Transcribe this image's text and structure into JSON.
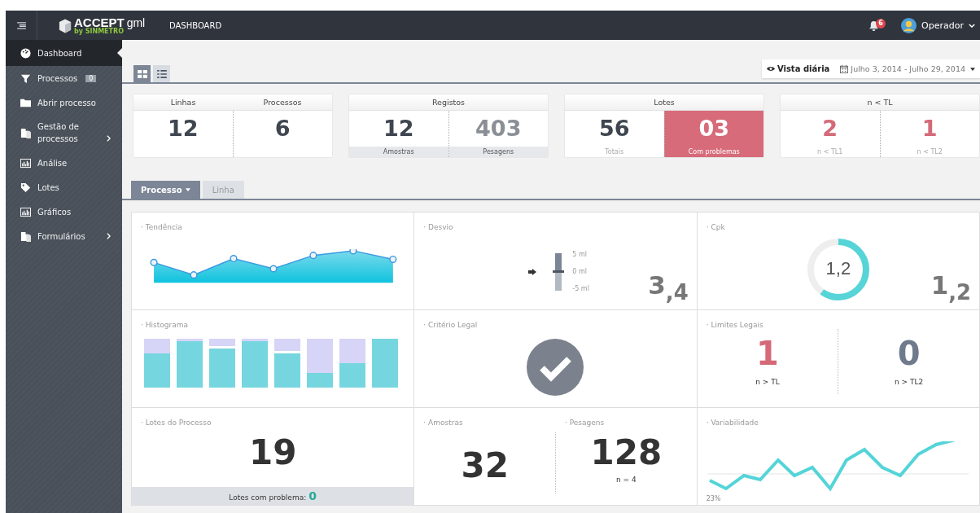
{
  "topbar": {
    "brand": "ACCEPT",
    "brand_suffix": "gml",
    "byline": "by SINMETRO",
    "page_title": "DASHBOARD",
    "notifications": "6",
    "user": "Operador"
  },
  "sidebar": {
    "items": [
      {
        "label": "Dashboard",
        "kind": "gauge",
        "selected": true,
        "expandable": false
      },
      {
        "label": "Processos",
        "kind": "filter",
        "badge": "0",
        "selected": false,
        "expandable": false
      },
      {
        "label": "Abrir processo",
        "kind": "folder",
        "selected": false,
        "expandable": false
      },
      {
        "label": "Gestão de processos",
        "kind": "document",
        "selected": false,
        "expandable": true
      },
      {
        "label": "Análise",
        "kind": "chart",
        "selected": false,
        "expandable": false
      },
      {
        "label": "Lotes",
        "kind": "tag",
        "selected": false,
        "expandable": false
      },
      {
        "label": "Gráficos",
        "kind": "chart",
        "selected": false,
        "expandable": false
      },
      {
        "label": "Formulários",
        "kind": "document",
        "selected": false,
        "expandable": true
      }
    ]
  },
  "view_toggle": [
    {
      "kind": "grid",
      "selected": true
    },
    {
      "kind": "list",
      "selected": false
    }
  ],
  "date_bar": {
    "view": "Vista diária",
    "range": "Julho 3, 2014 - Julho 29, 2014"
  },
  "stat_cards": [
    {
      "headers": [
        "Linhas",
        "Processos"
      ],
      "cells": [
        {
          "value": "12",
          "color": "#3f4650",
          "highlighted": false
        },
        {
          "value": "6",
          "color": "#3f4650",
          "highlighted": false
        }
      ]
    },
    {
      "headers": [
        "Registos"
      ],
      "shaded_captions": true,
      "cells": [
        {
          "value": "12",
          "caption": "Amostras",
          "color": "#3f4650",
          "highlighted": false
        },
        {
          "value": "403",
          "caption": "Pesagens",
          "color": "#8a8f96",
          "highlighted": false
        }
      ]
    },
    {
      "headers": [
        "Lotes"
      ],
      "shaded_captions": false,
      "cells": [
        {
          "value": "56",
          "caption": "Totais",
          "color": "#3f4650",
          "highlighted": false
        },
        {
          "value": "03",
          "caption": "Com problemas",
          "color": "#ffffff",
          "highlighted": true
        }
      ]
    },
    {
      "headers": [
        "n < TL"
      ],
      "shaded_captions": false,
      "cells": [
        {
          "value": "2",
          "caption": "n < TL1",
          "color": "#d46a77",
          "highlighted": false
        },
        {
          "value": "1",
          "caption": "n < TL2",
          "color": "#d46a77",
          "highlighted": false
        }
      ]
    }
  ],
  "tabs": [
    {
      "label": "Processo",
      "selected": true,
      "dropdown": true
    },
    {
      "label": "Linha",
      "selected": false,
      "dropdown": false
    }
  ],
  "panels": [
    {
      "kind": "trend",
      "title": "· Tendência"
    },
    {
      "kind": "deviation",
      "title": "· Desvio",
      "scale": [
        "5 ml",
        "0 ml",
        "-5 ml"
      ],
      "value": "3$_{,4}$"
    },
    {
      "kind": "cpk",
      "title": "· Cpk",
      "gauge_label": "1,2",
      "level": 0.6,
      "value": "1$_{,2}$"
    },
    {
      "kind": "histogram",
      "title": "· Histograma"
    },
    {
      "kind": "check",
      "title": "· Critério Legal",
      "passed": true
    },
    {
      "kind": "limits",
      "title": "· Limites Legais",
      "items": [
        {
          "value": "1",
          "label": "n > TL",
          "color": "#d46a77"
        },
        {
          "value": "0",
          "label": "n > TL2",
          "color": "#6f7b8c"
        }
      ]
    },
    {
      "kind": "lots",
      "title": "· Lotes do Processo",
      "value": "19",
      "footer": "Lotes com problema:",
      "footer_value": "0"
    },
    {
      "kind": "samples",
      "items": [
        {
          "title": "· Amostras",
          "value": "32"
        },
        {
          "title": "· Pesagens",
          "value": "128",
          "note": "n = 4"
        }
      ]
    },
    {
      "kind": "variability",
      "title": "· Variabilidade",
      "axis_label": "23%"
    }
  ]
}
